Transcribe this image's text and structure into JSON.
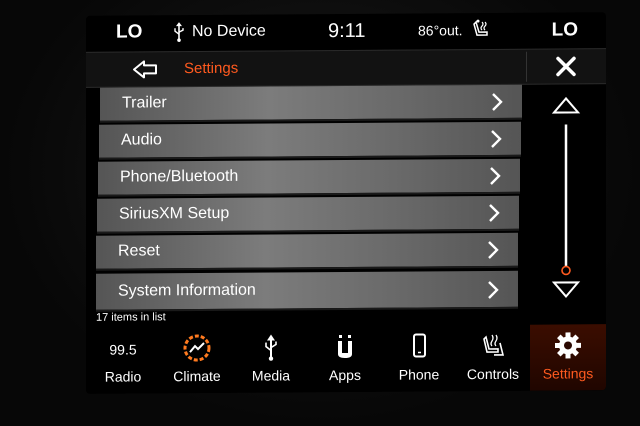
{
  "status": {
    "lo_left": "LO",
    "device": "No Device",
    "time": "9:11",
    "temp": "86°out.",
    "lo_right": "LO"
  },
  "header": {
    "title": "Settings",
    "accent": "#ff5a1f"
  },
  "settings_list": [
    {
      "label": "Trailer"
    },
    {
      "label": "Audio"
    },
    {
      "label": "Phone/Bluetooth"
    },
    {
      "label": "SiriusXM Setup"
    },
    {
      "label": "Reset"
    },
    {
      "label": "System Information"
    }
  ],
  "list_info": "17 items in list",
  "nav": {
    "radio": {
      "label": "Radio",
      "value": "99.5"
    },
    "climate": {
      "label": "Climate"
    },
    "media": {
      "label": "Media"
    },
    "apps": {
      "label": "Apps"
    },
    "phone": {
      "label": "Phone"
    },
    "controls": {
      "label": "Controls"
    },
    "settings": {
      "label": "Settings",
      "active": true
    }
  },
  "icons": [
    "usb-icon",
    "seat-heat-icon",
    "back-arrow-icon",
    "close-icon",
    "chevron-right-icon",
    "scroll-up-icon",
    "scroll-down-icon",
    "climate-icon",
    "apps-icon",
    "phone-icon",
    "controls-icon",
    "gear-icon"
  ]
}
